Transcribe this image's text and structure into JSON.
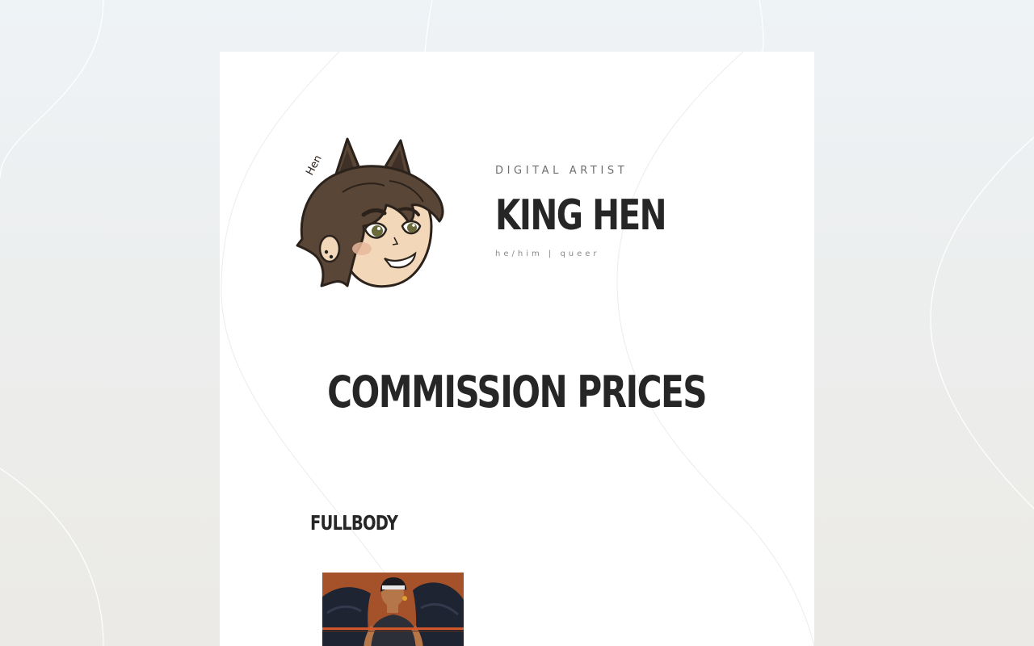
{
  "header": {
    "subtitle": "DIGITAL ARTIST",
    "title": "KING HEN",
    "tagline": "he/him | queer"
  },
  "avatar": {
    "icon": "artist-avatar-icon",
    "signature": "Hen"
  },
  "section": {
    "heading": "COMMISSION PRICES"
  },
  "categories": [
    {
      "label": "FULLBODY",
      "image": "fullbody-example-image"
    }
  ],
  "colors": {
    "text_dark": "#262626",
    "text_muted": "#6e6e6e",
    "card_bg": "#ffffff",
    "page_bg": "#eceeed",
    "thumb_bg": "#a5522a"
  }
}
